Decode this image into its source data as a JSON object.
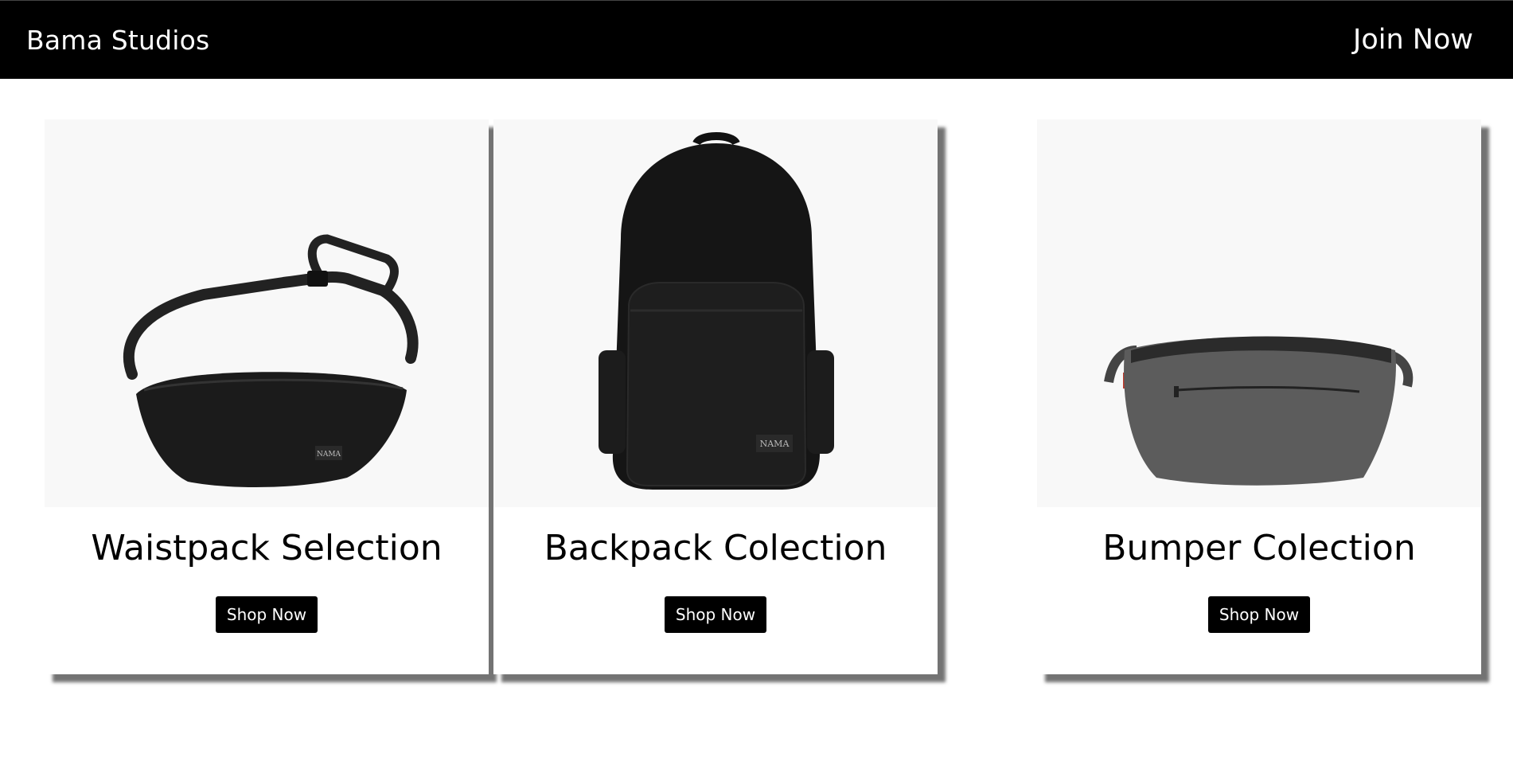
{
  "header": {
    "brand": "Bama Studios",
    "join_label": "Join Now"
  },
  "cards": [
    {
      "image_icon": "waistpack-image",
      "label_on_bag": "NAMA",
      "title": "Waistpack Selection",
      "button": "Shop Now"
    },
    {
      "image_icon": "backpack-image",
      "label_on_bag": "NAMA",
      "title": "Backpack Colection",
      "button": "Shop Now"
    },
    {
      "image_icon": "bumper-bag-image",
      "title": "Bumper Colection",
      "button": "Shop Now"
    }
  ],
  "colors": {
    "header_bg": "#000000",
    "button_bg": "#000000",
    "image_bg": "#f8f8f8",
    "bag_black": "#1a1a1a",
    "bag_grey": "#5a5a5a"
  }
}
